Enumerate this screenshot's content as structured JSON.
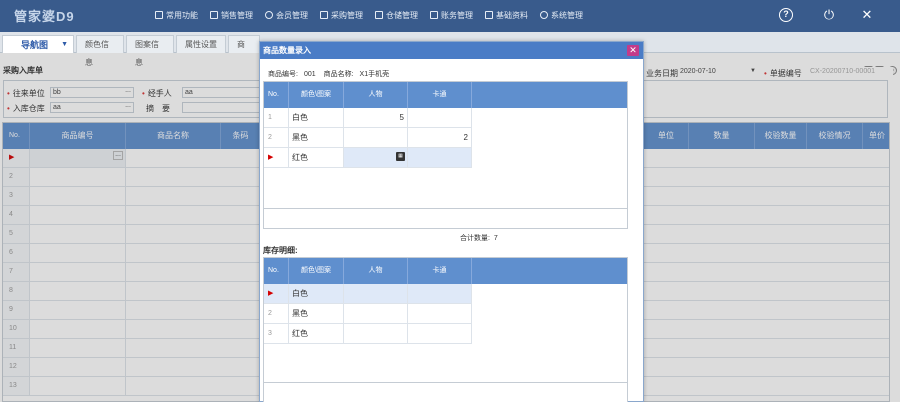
{
  "app": {
    "logo": "管家婆D9"
  },
  "topmenu": [
    {
      "label": "常用功能"
    },
    {
      "label": "销售管理"
    },
    {
      "label": "会员管理"
    },
    {
      "label": "采购管理"
    },
    {
      "label": "仓储管理"
    },
    {
      "label": "账务管理"
    },
    {
      "label": "基础资料"
    },
    {
      "label": "系统管理"
    }
  ],
  "tabs": {
    "nav": "导航图",
    "t1": "颜色信息",
    "t2": "图案信息",
    "t3": "属性设置",
    "t4": "商"
  },
  "form": {
    "title": "采购入库单",
    "supplier_label": "往来单位",
    "supplier_value": "bb",
    "handler_label": "经手人",
    "handler_value": "aa",
    "warehouse_label": "入库仓库",
    "warehouse_value": "aa",
    "summary_label": "摘　要",
    "date_label": "业务日期",
    "date_value": "2020-07-10",
    "billno_label": "单据编号",
    "billno_value": "CX-20200710-00001"
  },
  "grid": {
    "headers": [
      "No.",
      "商品编号",
      "商品名称",
      "条码",
      "单位",
      "数量",
      "校验数量",
      "校验情况",
      "单价"
    ],
    "rows": [
      "",
      "2",
      "3",
      "4",
      "5",
      "6",
      "7",
      "8",
      "9",
      "10",
      "11",
      "12",
      "13"
    ]
  },
  "dialog": {
    "title": "商品数量录入",
    "product_code_label": "商品编号:",
    "product_code": "001",
    "product_name_label": "商品名称:",
    "product_name": "X1手机壳",
    "input_table": {
      "headers": [
        "No.",
        "颜色\\图案",
        "人物",
        "卡通"
      ],
      "rows": [
        {
          "no": "1",
          "color": "白色",
          "v1": "5",
          "v2": ""
        },
        {
          "no": "2",
          "color": "黑色",
          "v1": "",
          "v2": "2"
        },
        {
          "no": "▶",
          "color": "红色",
          "v1": "",
          "v2": ""
        }
      ]
    },
    "total_label": "合计数量:",
    "total_value": "7",
    "stock_label": "库存明细:",
    "stock_table": {
      "headers": [
        "No.",
        "颜色\\图案",
        "人物",
        "卡通"
      ],
      "rows": [
        {
          "no": "▶",
          "color": "白色",
          "v1": "",
          "v2": ""
        },
        {
          "no": "2",
          "color": "黑色",
          "v1": "",
          "v2": ""
        },
        {
          "no": "3",
          "color": "红色",
          "v1": "",
          "v2": ""
        }
      ]
    }
  }
}
